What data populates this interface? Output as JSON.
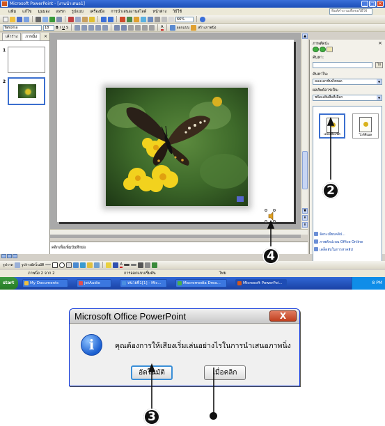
{
  "powerpoint": {
    "title": "Microsoft PowerPoint - [งานนำเสนอ1]",
    "menu": [
      "แฟ้ม",
      "แก้ไข",
      "มุมมอง",
      "แทรก",
      "รูปแบบ",
      "เครื่องมือ",
      "การนำเสนองานสไลด์",
      "หน้าต่าง",
      "วิธีใช้"
    ],
    "help_placeholder": "พิมพ์คำถามเพื่อขอวิธีใช้",
    "zoom": "66%",
    "toolbar_font": "Tahoma",
    "toolbar_size": "18",
    "toolbar_layout_label": "ออกแบบ",
    "toolbar_new_slide_label": "สร้างภาพนิ่ง",
    "left_tabs": [
      "เค้าร่าง",
      "ภาพนิ่ง"
    ],
    "slide_numbers": [
      "1",
      "2"
    ],
    "notes_placeholder": "คลิกเพื่อเพิ่มบันทึกย่อ",
    "task_pane": {
      "title": "ภาพตัดปะ",
      "search_label": "ค้นหา:",
      "search_value": "",
      "go_button": "ไป",
      "search_in_label": "ค้นหาใน:",
      "search_in_value": "คอลเลกชันทั้งหมด",
      "results_label": "ผลลัพธ์ควรเป็น:",
      "results_value": "ชนิดแฟ้มสื่อที่เลือก",
      "clips": [
        "แปลเสียงชัด",
        "ไวท์คิเนล"
      ],
      "links": [
        "จัดระเบียบคลิป...",
        "ภาพตัดปะบน Office Online",
        "เคล็ดลับในการหาคลิป"
      ]
    },
    "drawbar_draw_label": "รูปวาด",
    "drawbar_autoshape_label": "รูปร่างอัตโนมัติ",
    "status": {
      "slide": "ภาพนิ่ง 2 จาก 2",
      "design": "การออกแบบเริ่มต้น",
      "language": "ไทย"
    },
    "taskbar": {
      "start": "start",
      "items": [
        "My Documents",
        "jetAudio",
        "หน่วยที่1[1] - Mic...",
        "Macromedia Drea...",
        "Microsoft PowerPoi..."
      ],
      "item_colors": [
        "#f0c040",
        "#e05050",
        "#4a8fe0",
        "#4ab04a",
        "#d2581f"
      ],
      "clock": "8 PM"
    }
  },
  "dialog": {
    "title": "Microsoft Office PowerPoint",
    "close": "X",
    "icon": "info-icon",
    "message": "คุณต้องการให้เสียงเริ่มเล่นอย่างไรในการนำเสนอภาพนิ่ง",
    "button_auto": "อัตโนมัติ",
    "button_click": "เมื่อคลิก"
  },
  "callouts": {
    "clip_step": "2",
    "auto_step": "3",
    "sound_step": "4"
  },
  "accent_colors": {
    "xp_blue": "#1c4fb8",
    "selection_blue": "#3b6fcf",
    "dialog_close_red": "#c0401f"
  }
}
